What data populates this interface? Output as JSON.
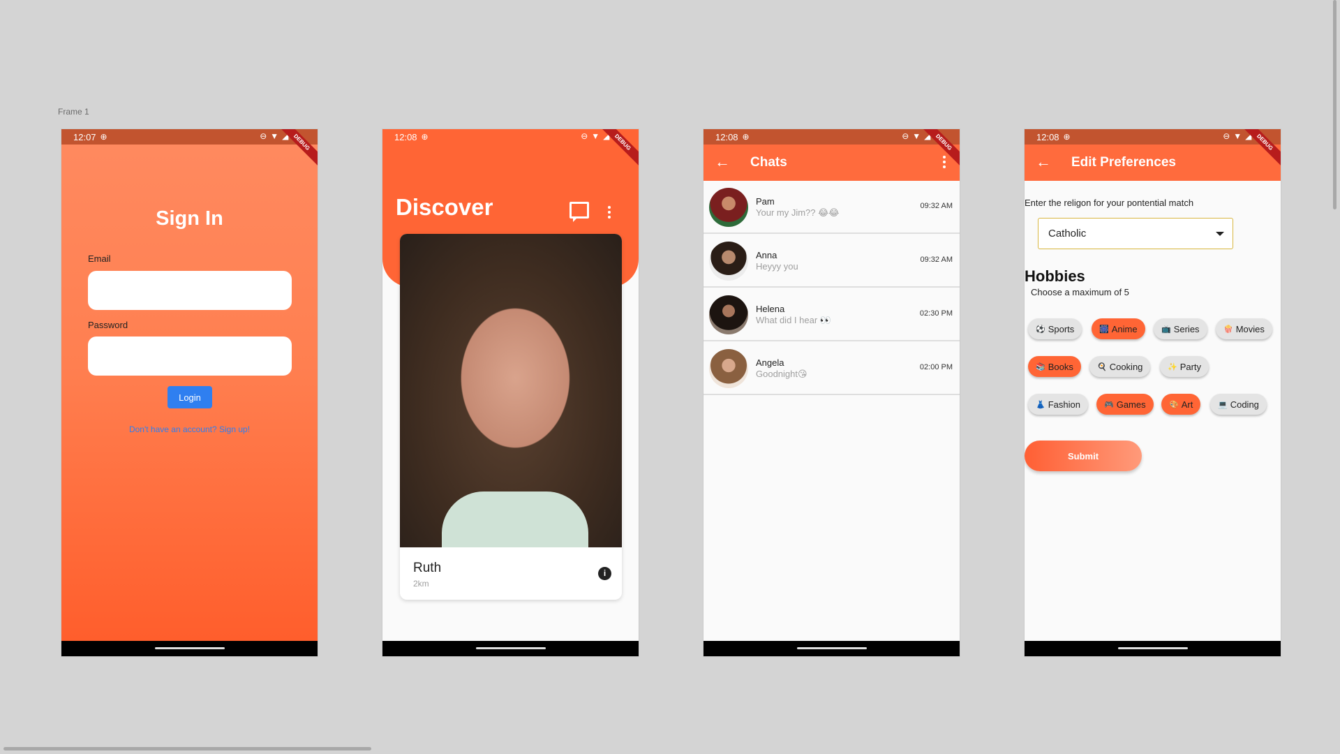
{
  "canvas": {
    "frame_label": "Frame 1"
  },
  "screens": {
    "signin": {
      "status_time": "12:07",
      "title": "Sign In",
      "email_label": "Email",
      "password_label": "Password",
      "email_value": "",
      "password_value": "",
      "login_label": "Login",
      "signup_link": "Don't have an account? Sign up!",
      "debug": "DEBUG"
    },
    "discover": {
      "status_time": "12:08",
      "title": "Discover",
      "profile": {
        "name": "Ruth",
        "distance": "2km"
      },
      "debug": "DEBUG"
    },
    "chats": {
      "status_time": "12:08",
      "title": "Chats",
      "debug": "DEBUG",
      "items": [
        {
          "name": "Pam",
          "message": "Your my Jim?? 😂😂",
          "time": "09:32 AM"
        },
        {
          "name": "Anna",
          "message": "Heyyy you",
          "time": "09:32 AM"
        },
        {
          "name": "Helena",
          "message": "What did I hear 👀",
          "time": "02:30 PM"
        },
        {
          "name": "Angela",
          "message": "Goodnight😘",
          "time": "02:00 PM"
        }
      ]
    },
    "preferences": {
      "status_time": "12:08",
      "title": "Edit Preferences",
      "debug": "DEBUG",
      "religion_prompt": "Enter the religon for your pontential match",
      "religion_value": "Catholic",
      "hobbies_title": "Hobbies",
      "hobbies_subtitle": "Choose a maximum of 5",
      "submit_label": "Submit",
      "hobbies": [
        {
          "label": "Sports",
          "icon": "⚽",
          "selected": false
        },
        {
          "label": "Anime",
          "icon": "🎆",
          "selected": true
        },
        {
          "label": "Series",
          "icon": "📺",
          "selected": false
        },
        {
          "label": "Movies",
          "icon": "🍿",
          "selected": false
        },
        {
          "label": "Books",
          "icon": "📚",
          "selected": true
        },
        {
          "label": "Cooking",
          "icon": "🍳",
          "selected": false
        },
        {
          "label": "Party",
          "icon": "✨",
          "selected": false
        },
        {
          "label": "Fashion",
          "icon": "👗",
          "selected": false
        },
        {
          "label": "Games",
          "icon": "🎮",
          "selected": true
        },
        {
          "label": "Art",
          "icon": "🎨",
          "selected": true
        },
        {
          "label": "Coding",
          "icon": "💻",
          "selected": false
        }
      ]
    }
  },
  "colors": {
    "accent": "#ff6535",
    "status_bar": "#c2542f",
    "link_blue": "#2f7ff0",
    "chip_off": "#e4e4e4"
  }
}
